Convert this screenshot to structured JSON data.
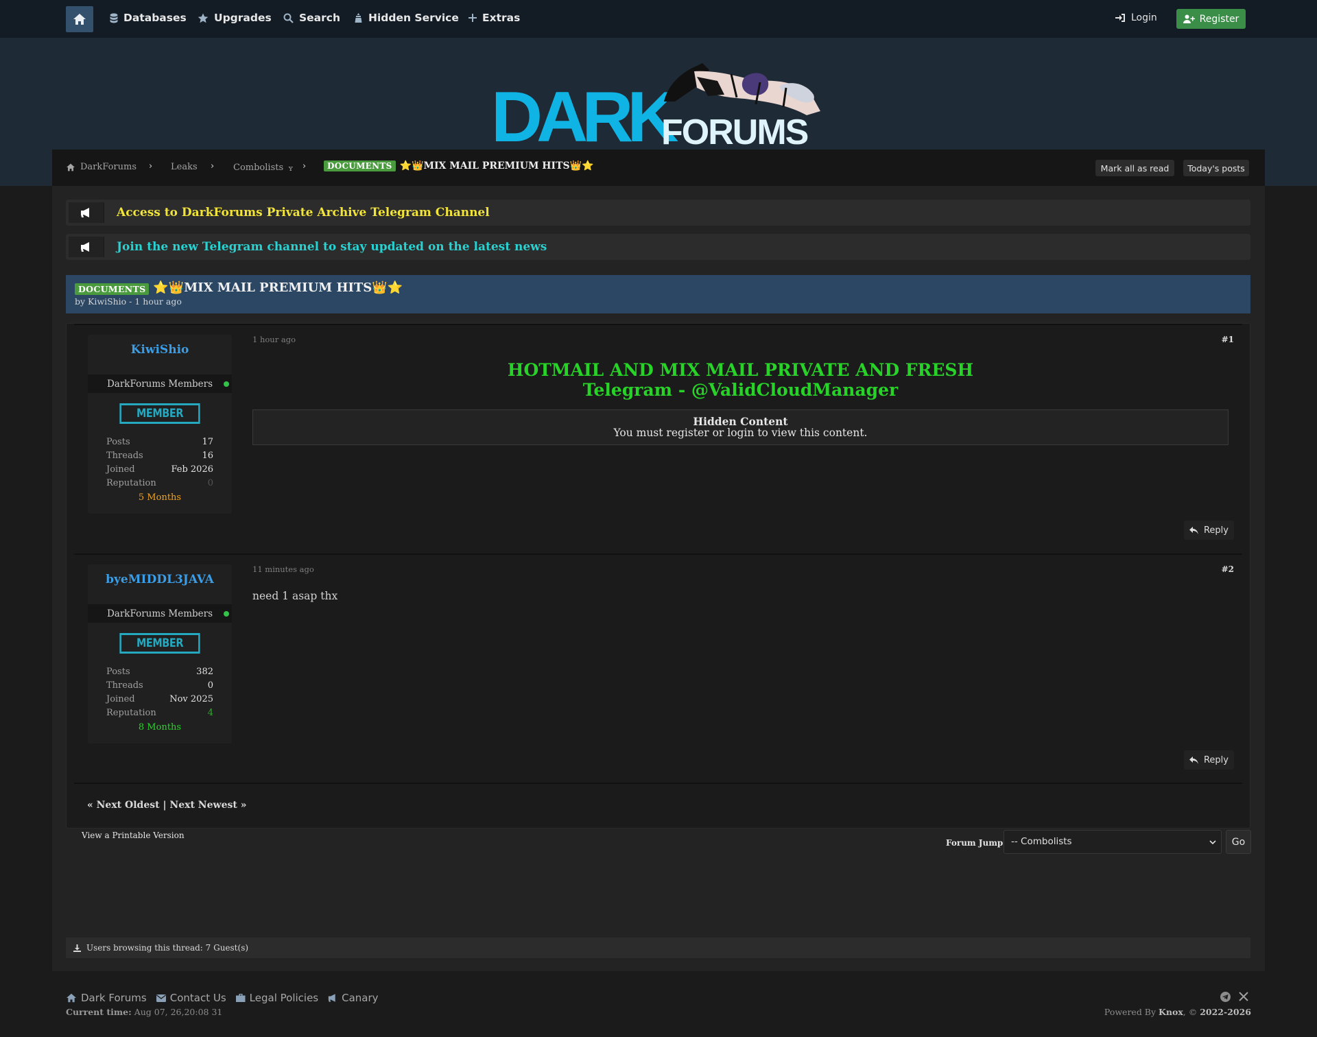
{
  "nav": {
    "items": [
      {
        "label": "Databases",
        "icon": "database-icon"
      },
      {
        "label": "Upgrades",
        "icon": "star-icon"
      },
      {
        "label": "Search",
        "icon": "search-icon"
      },
      {
        "label": "Hidden Service",
        "icon": "tor-icon"
      },
      {
        "label": "Extras",
        "icon": "plus-icon"
      }
    ],
    "login": "Login",
    "register": "Register"
  },
  "logo": {
    "word1": "DARK",
    "word2": "FORUMS"
  },
  "breadcrumb": {
    "items": [
      "DarkForums",
      "Leaks",
      "Combolists"
    ],
    "caret": "ʏ",
    "badge": "DOCUMENTS",
    "title": "⭐👑MIX MAIL PREMIUM HITS👑⭐",
    "mark_read": "Mark all as read",
    "todays_posts": "Today's posts"
  },
  "announcements": [
    {
      "text": "Access to DarkForums Private Archive Telegram Channel",
      "color": "#f3e43a"
    },
    {
      "text": "Join the new Telegram channel to stay updated on the latest news",
      "color": "#2ad1d1"
    }
  ],
  "thread": {
    "badge": "DOCUMENTS",
    "title": "⭐👑MIX MAIL PREMIUM HITS👑⭐",
    "byline": "by KiwiShio - 1 hour ago"
  },
  "posts": [
    {
      "author": "KiwiShio",
      "group": "DarkForums Members",
      "rank": "MEMBER",
      "stats": [
        {
          "k": "Posts",
          "v": "17"
        },
        {
          "k": "Threads",
          "v": "16"
        },
        {
          "k": "Joined",
          "v": "Feb 2026"
        },
        {
          "k": "Reputation",
          "v": "0"
        }
      ],
      "tenure": "5 Months",
      "date": "1 hour ago",
      "num": "#1",
      "headline1": "HOTMAIL AND MIX MAIL PRIVATE AND FRESH",
      "headline2": "Telegram - @ValidCloudManager",
      "hidden_title": "Hidden Content",
      "hidden_text": "You must register or login to view this content.",
      "reply": "Reply"
    },
    {
      "author": "byeMIDDL3JAVA",
      "group": "DarkForums Members",
      "rank": "MEMBER",
      "stats": [
        {
          "k": "Posts",
          "v": "382"
        },
        {
          "k": "Threads",
          "v": "0"
        },
        {
          "k": "Joined",
          "v": "Nov 2025"
        },
        {
          "k": "Reputation",
          "v": "4"
        }
      ],
      "tenure": "8 Months",
      "date": "11 minutes ago",
      "num": "#2",
      "body": "need 1 asap thx",
      "reply": "Reply"
    }
  ],
  "pager": "« Next Oldest | Next Newest »",
  "printable": "View a Printable Version",
  "forum_jump": {
    "label": "Forum Jump:",
    "selected": "-- Combolists",
    "go": "Go"
  },
  "browsing": "Users browsing this thread: 7 Guest(s)",
  "footer": {
    "links": [
      "Dark Forums",
      "Contact Us",
      "Legal Policies",
      "Canary"
    ],
    "current_time_label": "Current time:",
    "current_time": "Aug 07, 26,20:08 31",
    "powered_prefix": "Powered By",
    "powered_name": "Knox",
    "copyright": ", ©",
    "years": "2022-2026"
  },
  "colors": {
    "accent_blue": "#3b9de6",
    "green": "#28d228",
    "rank_teal": "#25a9c0",
    "tenure_orange": "#f2a21b",
    "tenure_green": "#2bd42b"
  }
}
